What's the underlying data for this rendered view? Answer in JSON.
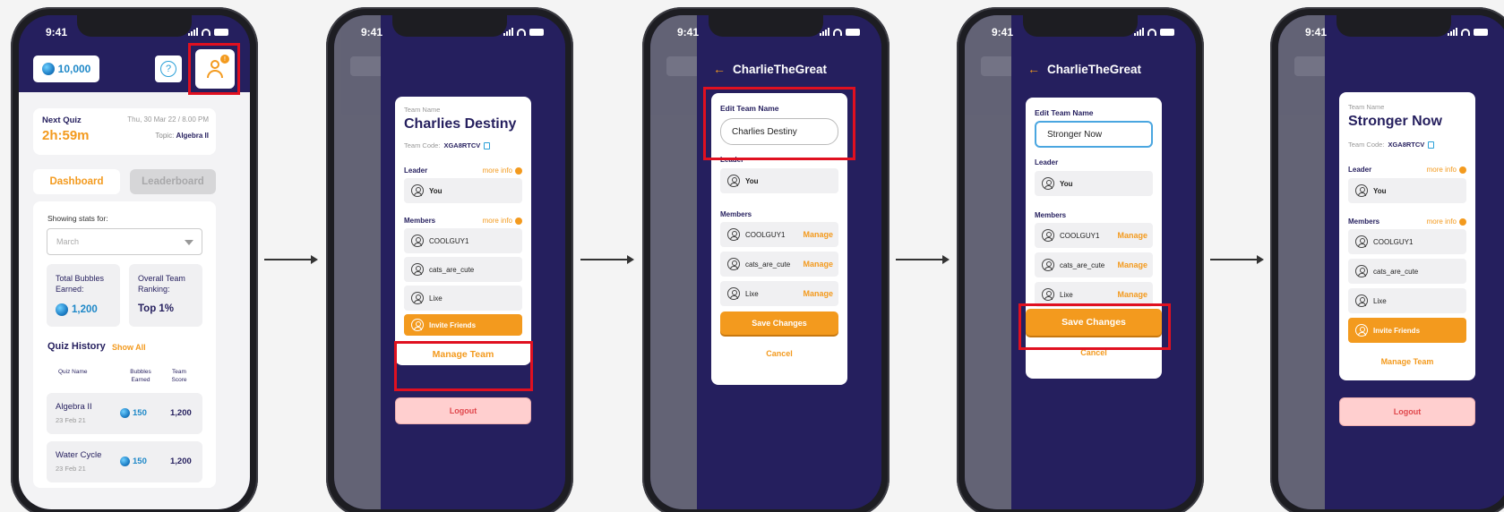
{
  "status": {
    "time": "9:41"
  },
  "screen1": {
    "bubbles": "10,000",
    "help": "?",
    "profile_badge": "!",
    "next_quiz_label": "Next Quiz",
    "next_quiz_time": "2h:59m",
    "next_quiz_date": "Thu, 30 Mar 22 / 8.00 PM",
    "topic_label": "Topic:",
    "topic_value": "Algebra II",
    "tabs": [
      "Dashboard",
      "Leaderboard"
    ],
    "showing": "Showing stats for:",
    "month": "March",
    "stat_total_label": "Total Bubbles Earned:",
    "stat_total_value": "1,200",
    "stat_rank_label": "Overall Team Ranking:",
    "stat_rank_value": "Top 1%",
    "quiz_history": "Quiz History",
    "show_all": "Show All",
    "headers": [
      "Quiz Name",
      "Bubbles Earned",
      "Team Score"
    ],
    "rows": [
      {
        "name": "Algebra II",
        "date": "23 Feb 21",
        "bubbles": "150",
        "score": "1,200"
      },
      {
        "name": "Water Cycle",
        "date": "23 Feb 21",
        "bubbles": "150",
        "score": "1,200"
      }
    ]
  },
  "team": {
    "name_label": "Team Name",
    "name_initial": "Charlies Destiny",
    "name_final": "Stronger Now",
    "code_label": "Team Code:",
    "code": "XGA8RTCV",
    "leader_label": "Leader",
    "members_label": "Members",
    "more_info": "more info",
    "leader": "You",
    "members": [
      "COOLGUY1",
      "cats_are_cute",
      "Lixe"
    ],
    "invite": "Invite Friends",
    "manage_team": "Manage Team",
    "logout": "Logout"
  },
  "edit": {
    "username": "CharlieTheGreat",
    "edit_label": "Edit Team Name",
    "input_initial": "Charlies Destiny",
    "input_new": "Stronger Now",
    "manage": "Manage",
    "save": "Save Changes",
    "cancel": "Cancel"
  },
  "colors": {
    "navy": "#251f5e",
    "orange": "#f39a1e",
    "blue": "#1e88c8",
    "highlight": "#e01020",
    "logout_bg": "#ffcfcf"
  }
}
